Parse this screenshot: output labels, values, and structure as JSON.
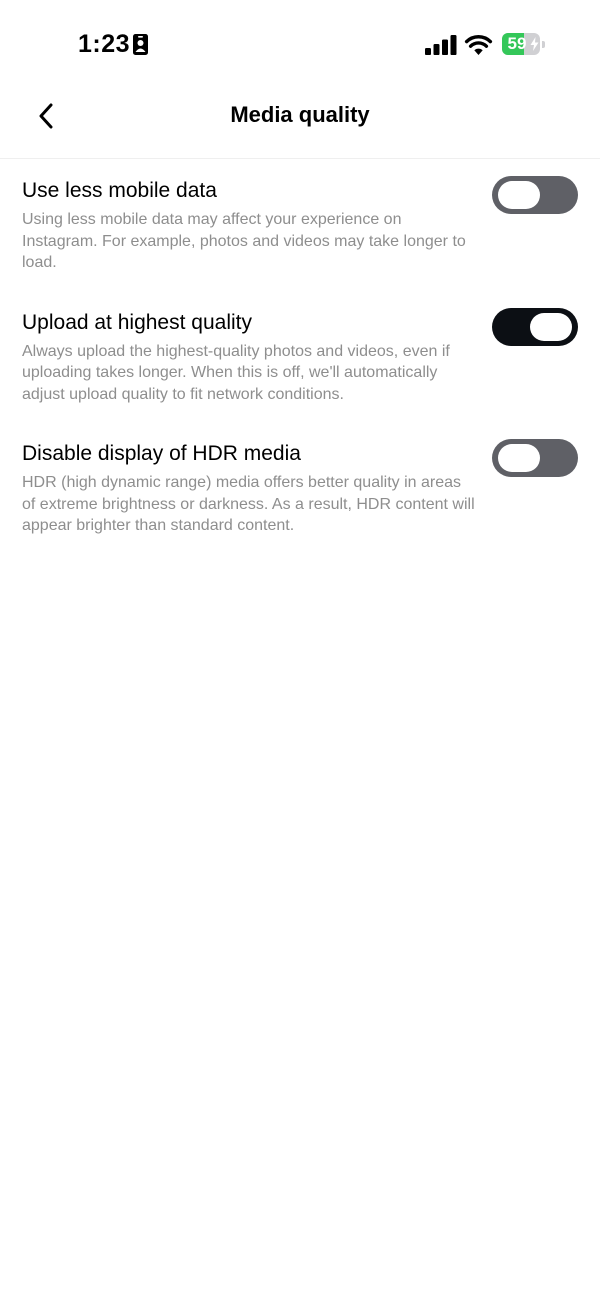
{
  "status_bar": {
    "time": "1:23",
    "battery_level": "59",
    "battery_fraction": 0.59,
    "icons": [
      "id-card-icon",
      "signal-icon",
      "wifi-icon",
      "battery-icon",
      "charging-bolt-icon"
    ]
  },
  "header": {
    "title": "Media quality",
    "back_icon": "chevron-left-icon"
  },
  "settings": [
    {
      "title": "Use less mobile data",
      "description": "Using less mobile data may affect your experience on Instagram. For example, photos and videos may take longer to load.",
      "enabled": false
    },
    {
      "title": "Upload at highest quality",
      "description": "Always upload the highest-quality photos and videos, even if uploading takes longer. When this is off, we'll automatically adjust upload quality to fit network conditions.",
      "enabled": true
    },
    {
      "title": "Disable display of HDR media",
      "description": "HDR (high dynamic range) media offers better quality in areas of extreme brightness or darkness. As a result, HDR content will appear brighter than standard content.",
      "enabled": false
    }
  ],
  "colors": {
    "toggle_off": "#5f6066",
    "toggle_on": "#0c0f14",
    "battery_fill": "#34c759",
    "description_text": "#8e8e8e"
  }
}
